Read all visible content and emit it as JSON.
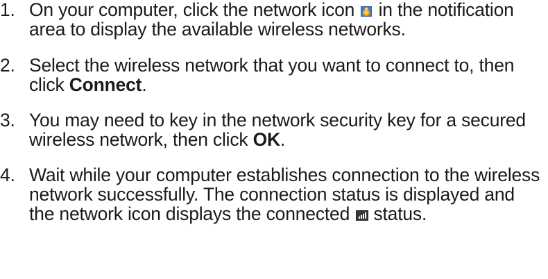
{
  "steps": [
    {
      "number": "1.",
      "text_before_icon": "On your computer, click the network icon",
      "icon": "network-disconnected-icon",
      "text_after_icon": "in the notification area to display the available wireless networks."
    },
    {
      "number": "2.",
      "text_before_bold": "Select the wireless network that you want to connect to, then click",
      "bold": "Connect",
      "text_after_bold": "."
    },
    {
      "number": "3.",
      "text_before_bold": "You may need to key in the network security key for a secured wireless network, then click",
      "bold": "OK",
      "text_after_bold": "."
    },
    {
      "number": "4.",
      "text_before_icon": "Wait while your computer establishes connection to the wireless network successfully. The connection status is displayed and the network icon displays the connected",
      "icon": "network-connected-icon",
      "text_after_icon": "status."
    }
  ]
}
